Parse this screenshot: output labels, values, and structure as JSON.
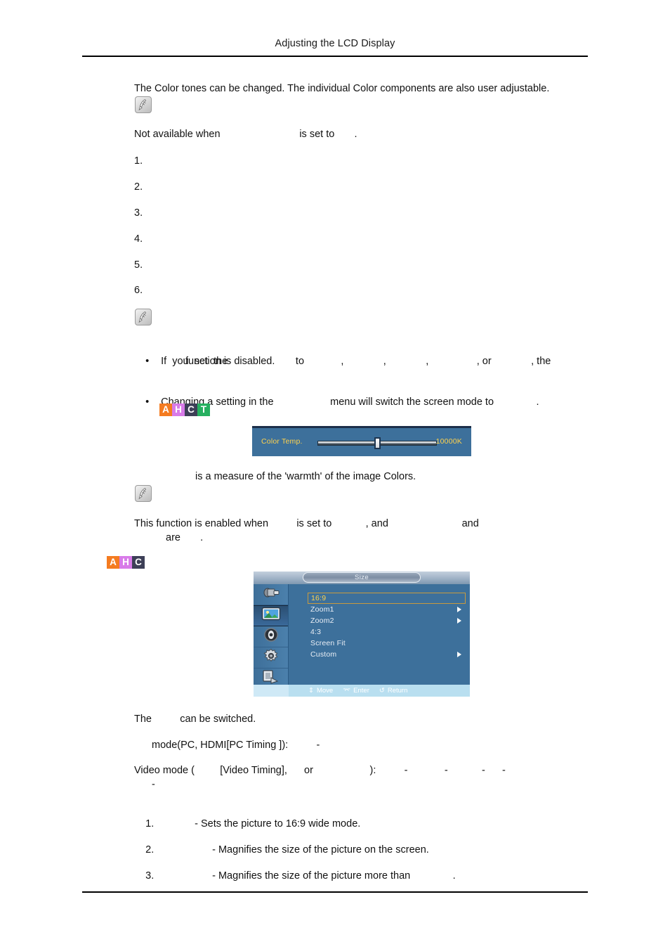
{
  "header": {
    "title": "Adjusting the LCD Display"
  },
  "body": {
    "intro": "The Color tones can be changed. The individual Color components are also user adjustable.",
    "not_available": "Not available when                            is set to       .",
    "steps": [
      "1.",
      "2.",
      "3.",
      "4.",
      "5.",
      "6."
    ],
    "bullets": [
      {
        "line1": "If  you  set  the                        to             ,              ,              ,                 , or              , the",
        "line2": "function is disabled."
      },
      {
        "line1": "Changing a setting in the                    menu will switch the screen mode to               ."
      }
    ],
    "color_temp_caption": "is a measure of the 'warmth' of the image Colors.",
    "enabled_note_line1": "This function is enabled when          is set to            , and                          and",
    "enabled_note_line2": "are       .",
    "size_caption": "The          can be switched.",
    "pc_mode_line": "mode(PC, HDMI[PC Timing ]):          -",
    "video_mode_line": "Video mode (         [Video Timing],      or                    ):          -             -            -      -",
    "video_mode_line2": "-",
    "size_items": [
      {
        "num": "1.",
        "text": "- Sets the picture to 16:9 wide mode.",
        "indent": 70
      },
      {
        "num": "2.",
        "text": "- Magnifies the size of the picture on the screen.",
        "indent": 95
      },
      {
        "num": "3.",
        "text": "- Magnifies the size of the picture more than               .",
        "indent": 95
      }
    ]
  },
  "badges": {
    "ahct": {
      "letters": [
        "A",
        "H",
        "C",
        "T"
      ],
      "colors": [
        "#F47B20",
        "#D87BE8",
        "#3D3F57",
        "#27B060"
      ]
    },
    "ahc": {
      "letters": [
        "A",
        "H",
        "C"
      ],
      "colors": [
        "#F47B20",
        "#D87BE8",
        "#3D3F57"
      ]
    }
  },
  "osd_color_temp": {
    "label": "Color Temp.",
    "value": "10000K",
    "slider_position_percent": 50,
    "accent_color": "#ffd24d",
    "background_color": "#3d709b"
  },
  "osd_size_menu": {
    "title": "Size",
    "sidebar_icons": [
      "input-source-icon",
      "picture-icon",
      "sound-icon",
      "setup-gear-icon",
      "multi-control-icon"
    ],
    "selected_sidebar_index": 1,
    "items": [
      {
        "label": "16:9",
        "selected": true,
        "has_submenu": false
      },
      {
        "label": "Zoom1",
        "selected": false,
        "has_submenu": true
      },
      {
        "label": "Zoom2",
        "selected": false,
        "has_submenu": true
      },
      {
        "label": "4:3",
        "selected": false,
        "has_submenu": false
      },
      {
        "label": "Screen Fit",
        "selected": false,
        "has_submenu": false
      },
      {
        "label": "Custom",
        "selected": false,
        "has_submenu": true
      }
    ],
    "footer": [
      {
        "icon": "updown-arrow-icon",
        "label": "Move"
      },
      {
        "icon": "enter-icon",
        "label": "Enter"
      },
      {
        "icon": "return-icon",
        "label": "Return"
      }
    ]
  },
  "icons": {
    "note": "note-pen-icon"
  }
}
